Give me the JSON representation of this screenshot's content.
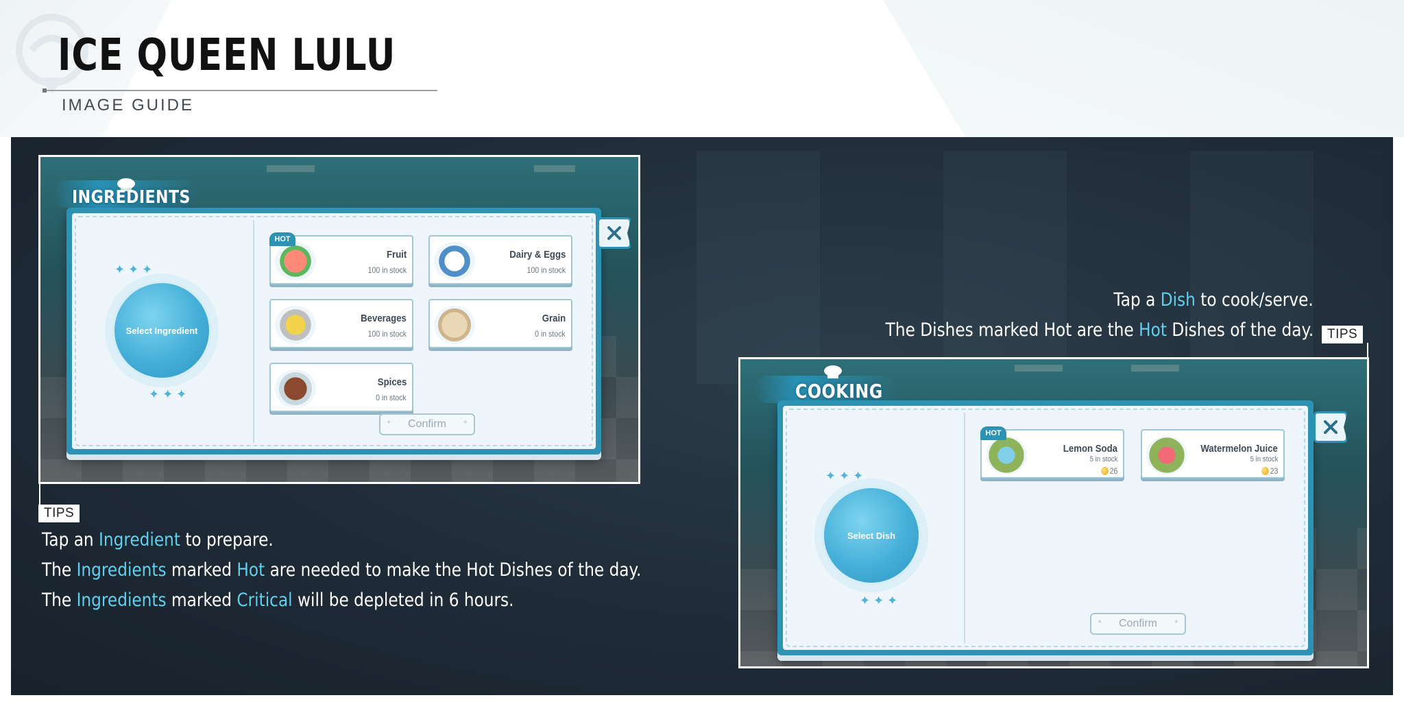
{
  "header": {
    "title": "ICE QUEEN LULU",
    "subtitle": "IMAGE GUIDE"
  },
  "ingredients_panel": {
    "title": "INGREDIENTS",
    "select_label": "Select Ingredient",
    "close_icon": "close-icon",
    "confirm_label": "Confirm",
    "items": [
      {
        "name": "Fruit",
        "stock": "100 in stock",
        "hot": true,
        "hot_label": "HOT",
        "icon": "fruit-icon"
      },
      {
        "name": "Dairy & Eggs",
        "stock": "100 in stock",
        "hot": false,
        "icon": "dairy-eggs-icon"
      },
      {
        "name": "Beverages",
        "stock": "100 in stock",
        "hot": false,
        "icon": "beverages-icon"
      },
      {
        "name": "Grain",
        "stock": "0 in stock",
        "hot": false,
        "icon": "grain-icon"
      },
      {
        "name": "Spices",
        "stock": "0 in stock",
        "hot": false,
        "icon": "spices-icon"
      }
    ]
  },
  "cooking_panel": {
    "title": "COOKING",
    "select_label": "Select Dish",
    "close_icon": "close-icon",
    "confirm_label": "Confirm",
    "dishes": [
      {
        "name": "Lemon Soda",
        "stock": "5 in stock",
        "price": "26",
        "hot": true,
        "hot_label": "HOT",
        "icon": "lemon-soda-icon"
      },
      {
        "name": "Watermelon Juice",
        "stock": "5 in stock",
        "price": "23",
        "hot": false,
        "icon": "watermelon-juice-icon"
      }
    ]
  },
  "tips_left": {
    "tag": "TIPS",
    "lines": [
      [
        {
          "t": "Tap an "
        },
        {
          "t": "Ingredient",
          "hl": true
        },
        {
          "t": " to prepare."
        }
      ],
      [
        {
          "t": "The "
        },
        {
          "t": "Ingredients",
          "hl": true
        },
        {
          "t": " marked "
        },
        {
          "t": "Hot",
          "hl": true
        },
        {
          "t": " are needed to make the Hot Dishes of the day."
        }
      ],
      [
        {
          "t": "The "
        },
        {
          "t": "Ingredients",
          "hl": true
        },
        {
          "t": " marked "
        },
        {
          "t": "Critical",
          "hl": true
        },
        {
          "t": " will be depleted in 6 hours."
        }
      ]
    ]
  },
  "tips_right": {
    "tag": "TIPS",
    "lines": [
      [
        {
          "t": "Tap a "
        },
        {
          "t": "Dish",
          "hl": true
        },
        {
          "t": " to cook/serve."
        }
      ],
      [
        {
          "t": "The Dishes marked Hot are the "
        },
        {
          "t": "Hot",
          "hl": true
        },
        {
          "t": " Dishes of the day."
        }
      ]
    ]
  },
  "colors": {
    "highlight": "#5fd0ee",
    "panel_bg": "#1e2a36",
    "dialog_accent": "#2c93b4"
  }
}
